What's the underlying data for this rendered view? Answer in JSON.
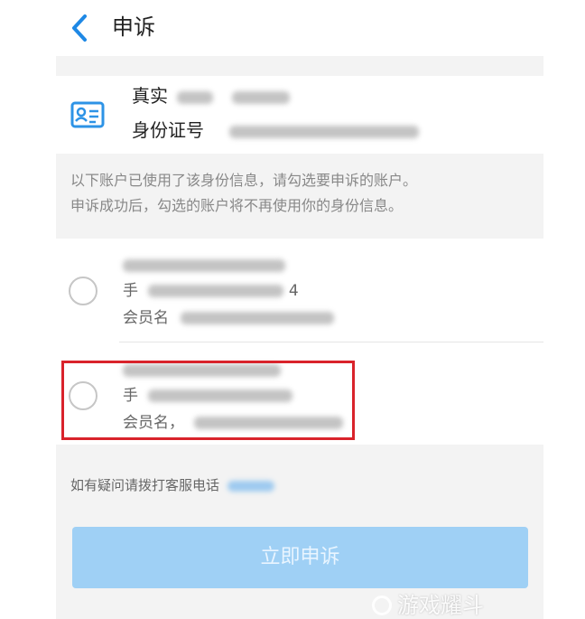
{
  "header": {
    "title": "申诉",
    "back_icon": "chevron-left-icon",
    "accent": "#1e88e5"
  },
  "identity": {
    "icon": "id-card-icon",
    "name_label": "真实",
    "id_label": "身份证号"
  },
  "notice": {
    "line1": "以下账户已使用了该身份信息，请勾选要申诉的账户。",
    "line2": "申诉成功后，勾选的账户将不再使用你的身份信息。"
  },
  "accounts": [
    {
      "line1": "",
      "phone_prefix": "手",
      "phone_suffix": "4",
      "member_label": "会员名",
      "selected": false
    },
    {
      "line1": "",
      "phone_prefix": "手",
      "phone_suffix": "",
      "member_label": "会员名，",
      "selected": false
    }
  ],
  "help": {
    "text": "如有疑问请拨打客服电话"
  },
  "submit": {
    "label": "立即申诉",
    "color": "#9fd0f5"
  },
  "watermark": {
    "text": "游戏耀斗"
  }
}
